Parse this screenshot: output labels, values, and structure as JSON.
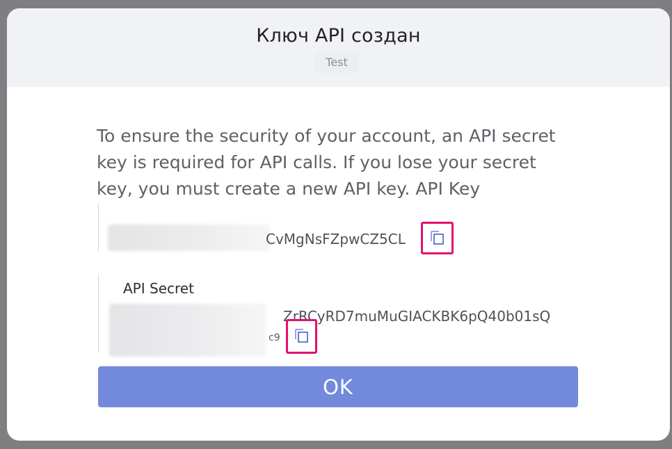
{
  "modal": {
    "title": "Ключ API создан",
    "subtitle": "Test",
    "description": "To ensure the security of your account, an API secret key is required for API calls. If you lose your secret key, you must create a new API key. API Key"
  },
  "api_key": {
    "visible_value": "CvMgNsFZpwCZ5CL",
    "copy_icon": "copy-icon"
  },
  "api_secret": {
    "label": "API Secret",
    "visible_value": "ZrRCyRD7muMuGIACKBK6pQ40b01sQ",
    "visible_tail": "c9",
    "copy_icon": "copy-icon"
  },
  "ok_button": {
    "label": "OK"
  },
  "colors": {
    "accent": "#7289dc",
    "highlight": "#e0126f",
    "header_bg": "#f1f2f5"
  }
}
